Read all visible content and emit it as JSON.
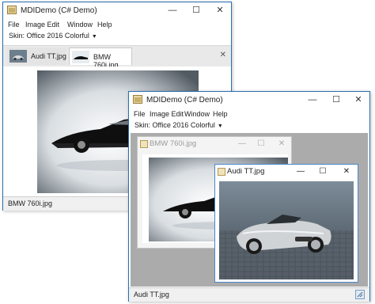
{
  "back_window": {
    "title": "MDIDemo (C# Demo)",
    "menu": [
      "File",
      "Image Edit",
      "Window",
      "Help"
    ],
    "skin_label": "Skin: Office 2016 Colorful",
    "tabs": [
      {
        "label": "Audi TT.jpg",
        "active": false
      },
      {
        "label": "BMW 760i.jpg",
        "active": true
      }
    ],
    "status": "BMW 760i.jpg"
  },
  "front_window": {
    "title": "MDIDemo (C# Demo)",
    "menu": [
      "File",
      "Image Edit",
      "Window",
      "Help"
    ],
    "skin_label": "Skin: Office 2016 Colorful",
    "children": [
      {
        "title": "BMW 760i.jpg",
        "active": false
      },
      {
        "title": "Audi TT.jpg",
        "active": true
      }
    ],
    "status": "Audi TT.jpg"
  },
  "icons": {
    "minimize": "minimize-icon",
    "maximize": "maximize-icon",
    "close": "close-icon",
    "tab_close": "close-icon",
    "dropdown": "chevron-down-icon"
  },
  "colors": {
    "window_border": "#2b6fb3",
    "mdi_background": "#ababab",
    "active_child_border": "#4a86c8"
  }
}
